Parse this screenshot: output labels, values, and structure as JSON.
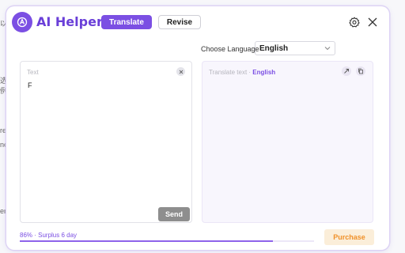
{
  "app": {
    "title": "AI Helper",
    "accent": "#7b4fe3"
  },
  "tabs": [
    {
      "label": "Translate",
      "active": true
    },
    {
      "label": "Revise",
      "active": false
    }
  ],
  "language": {
    "label": "Choose Language",
    "selected": "English"
  },
  "input": {
    "placeholder": "Text",
    "value": "F"
  },
  "send_label": "Send",
  "output": {
    "placeholder_prefix": "Translate text · ",
    "target_language": "English"
  },
  "footer": {
    "usage_text": "86% · Surplus 6 day",
    "usage_percent": 86,
    "purchase_label": "Purchase"
  },
  "background": {
    "fragments": [
      "以",
      "选",
      "例",
      "re",
      "nc",
      "lr",
      "er",
      "Jk"
    ]
  },
  "icons": {
    "logo": "app-logo-icon",
    "settings": "gear-icon",
    "close": "close-icon",
    "dropdown": "chevron-down-icon",
    "clear": "clear-icon",
    "share": "share-icon",
    "copy": "copy-icon"
  }
}
